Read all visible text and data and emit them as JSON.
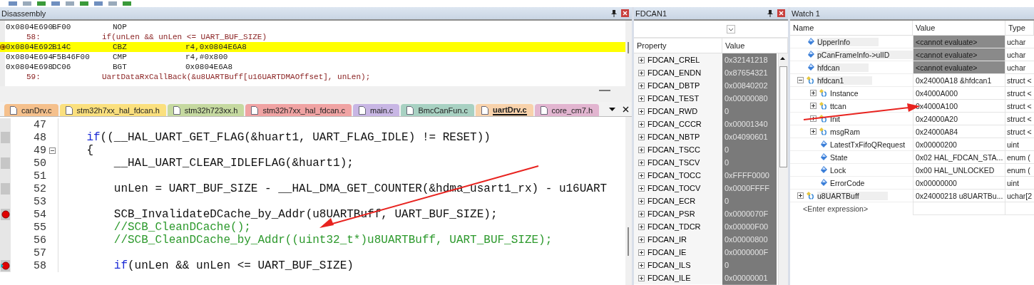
{
  "disassembly": {
    "title": "Disassembly",
    "rows": [
      {
        "kind": "instruction",
        "address": "0x0804E690",
        "opcode": "BF00",
        "mnemonic": "NOP",
        "current": false
      },
      {
        "kind": "source",
        "line": "58:",
        "code": "if(unLen && unLen <= UART_BUF_SIZE)"
      },
      {
        "kind": "instruction",
        "address": "0x0804E692",
        "opcode": "B14C",
        "mnemonic": "CBZ",
        "operands": "r4,0x0804E6A8",
        "current": true
      },
      {
        "kind": "instruction",
        "address": "0x0804E694",
        "opcode": "F5B46F00",
        "mnemonic": "CMP",
        "operands": "r4,#0x800",
        "current": false
      },
      {
        "kind": "instruction",
        "address": "0x0804E698",
        "opcode": "DC06",
        "mnemonic": "BGT",
        "operands": "0x0804E6A8",
        "current": false
      },
      {
        "kind": "source",
        "line": "59:",
        "code": "UartDataRxCallBack(&u8UARTBuff[u16UARTDMAOffset], unLen);"
      }
    ]
  },
  "editor": {
    "tabs": [
      {
        "label": "canDrv.c",
        "color": "#f5c08c",
        "selected": false
      },
      {
        "label": "stm32h7xx_hal_fdcan.h",
        "color": "#fbe07e",
        "selected": false
      },
      {
        "label": "stm32h723xx.h",
        "color": "#c5d9a0",
        "selected": false
      },
      {
        "label": "stm32h7xx_hal_fdcan.c",
        "color": "#f0a3a3",
        "selected": false
      },
      {
        "label": "main.c",
        "color": "#c8b6e4",
        "selected": false
      },
      {
        "label": "BmcCanFun.c",
        "color": "#a8d1c2",
        "selected": false
      },
      {
        "label": "uartDrv.c",
        "color": "#f8d2ab",
        "selected": true
      },
      {
        "label": "core_cm7.h",
        "color": "#e2b5d0",
        "selected": false
      }
    ],
    "lines": [
      {
        "number": "47",
        "executable": false,
        "breakpoint": false,
        "current": false,
        "fold": false
      },
      {
        "number": "48",
        "executable": true,
        "breakpoint": false,
        "current": false,
        "fold": false,
        "kind": "code",
        "parts": [
          {
            "kind": "keyword",
            "text": "    if"
          },
          {
            "kind": "plain",
            "text": "((__HAL_UART_GET_FLAG(&huart1, UART_FLAG_IDLE) != RESET))"
          }
        ]
      },
      {
        "number": "49",
        "executable": false,
        "breakpoint": false,
        "current": false,
        "fold": true,
        "kind": "code",
        "parts": [
          {
            "kind": "plain",
            "text": "    {"
          }
        ]
      },
      {
        "number": "50",
        "executable": true,
        "breakpoint": false,
        "current": false,
        "fold": false,
        "kind": "code",
        "parts": [
          {
            "kind": "plain",
            "text": "        __HAL_UART_CLEAR_IDLEFLAG(&huart1);"
          }
        ]
      },
      {
        "number": "51",
        "executable": false,
        "breakpoint": false,
        "current": false,
        "fold": false
      },
      {
        "number": "52",
        "executable": true,
        "breakpoint": false,
        "current": false,
        "fold": false,
        "kind": "code",
        "parts": [
          {
            "kind": "plain",
            "text": "        unLen = UART_BUF_SIZE - __HAL_DMA_GET_COUNTER(&hdma_usart1_rx) - u16UART"
          }
        ]
      },
      {
        "number": "53",
        "executable": false,
        "breakpoint": false,
        "current": false,
        "fold": false
      },
      {
        "number": "54",
        "executable": true,
        "breakpoint": true,
        "current": false,
        "fold": false,
        "kind": "code",
        "parts": [
          {
            "kind": "plain",
            "text": "        SCB_InvalidateDCache_by_Addr(u8UARTBuff, UART_BUF_SIZE);"
          }
        ]
      },
      {
        "number": "55",
        "executable": false,
        "breakpoint": false,
        "current": false,
        "fold": false,
        "kind": "comment",
        "parts": [
          {
            "kind": "plain",
            "text": "        //SCB_CleanDCache();"
          }
        ]
      },
      {
        "number": "56",
        "executable": false,
        "breakpoint": false,
        "current": false,
        "fold": false,
        "kind": "comment",
        "parts": [
          {
            "kind": "plain",
            "text": "        //SCB_CleanDCache_by_Addr((uint32_t*)u8UARTBuff, UART_BUF_SIZE);"
          }
        ]
      },
      {
        "number": "57",
        "executable": false,
        "breakpoint": false,
        "current": false,
        "fold": false
      },
      {
        "number": "58",
        "executable": true,
        "breakpoint": true,
        "current": true,
        "fold": false,
        "kind": "code",
        "parts": [
          {
            "kind": "keyword",
            "text": "        if"
          },
          {
            "kind": "plain",
            "text": "(unLen && unLen <= UART_BUF_SIZE)"
          }
        ]
      }
    ]
  },
  "registers": {
    "title": "FDCAN1",
    "columns": [
      "Property",
      "Value"
    ],
    "rows": [
      {
        "property": "FDCAN_CREL",
        "value": "0x32141218",
        "expanded": false
      },
      {
        "property": "FDCAN_ENDN",
        "value": "0x87654321",
        "expanded": false
      },
      {
        "property": "FDCAN_DBTP",
        "value": "0x00840202",
        "expanded": false
      },
      {
        "property": "FDCAN_TEST",
        "value": "0x00000080",
        "expanded": false
      },
      {
        "property": "FDCAN_RWD",
        "value": "0",
        "expanded": false
      },
      {
        "property": "FDCAN_CCCR",
        "value": "0x00001340",
        "expanded": false
      },
      {
        "property": "FDCAN_NBTP",
        "value": "0x04090601",
        "expanded": false
      },
      {
        "property": "FDCAN_TSCC",
        "value": "0",
        "expanded": false
      },
      {
        "property": "FDCAN_TSCV",
        "value": "0",
        "expanded": false
      },
      {
        "property": "FDCAN_TOCC",
        "value": "0xFFFF0000",
        "expanded": false
      },
      {
        "property": "FDCAN_TOCV",
        "value": "0x0000FFFF",
        "expanded": false
      },
      {
        "property": "FDCAN_ECR",
        "value": "0",
        "expanded": false
      },
      {
        "property": "FDCAN_PSR",
        "value": "0x0000070F",
        "expanded": false
      },
      {
        "property": "FDCAN_TDCR",
        "value": "0x00000F00",
        "expanded": false
      },
      {
        "property": "FDCAN_IR",
        "value": "0x00000800",
        "expanded": false
      },
      {
        "property": "FDCAN_IE",
        "value": "0x0000000F",
        "expanded": false
      },
      {
        "property": "FDCAN_ILS",
        "value": "0",
        "expanded": false
      },
      {
        "property": "FDCAN_ILE",
        "value": "0x00000001",
        "expanded": false
      }
    ]
  },
  "watch": {
    "title": "Watch 1",
    "columns": [
      "Name",
      "Value",
      "Type"
    ],
    "items": [
      {
        "name": "UpperInfo",
        "kind": "variable",
        "value": "<cannot evaluate>",
        "type": "uchar",
        "unavailable": true
      },
      {
        "name": "pCanFrameInfo->ulID",
        "kind": "variable",
        "value": "<cannot evaluate>",
        "type": "uchar",
        "unavailable": true
      },
      {
        "name": "hfdcan",
        "kind": "variable",
        "value": "<cannot evaluate>",
        "type": "uchar",
        "unavailable": true
      },
      {
        "name": "hfdcan1",
        "kind": "struct",
        "expanded": true,
        "value": "0x24000A18 &hfdcan1",
        "type": "struct <",
        "unavailable": false,
        "children": [
          {
            "name": "Instance",
            "kind": "struct",
            "expanded": false,
            "value": "0x4000A000",
            "type": "struct <",
            "unavailable": false
          },
          {
            "name": "ttcan",
            "kind": "struct",
            "expanded": false,
            "value": "0x4000A100",
            "type": "struct <",
            "unavailable": false
          },
          {
            "name": "Init",
            "kind": "struct",
            "expanded": false,
            "value": "0x24000A20",
            "type": "struct <",
            "unavailable": false
          },
          {
            "name": "msgRam",
            "kind": "struct",
            "expanded": false,
            "value": "0x24000A84",
            "type": "struct <",
            "unavailable": false
          },
          {
            "name": "LatestTxFifoQRequest",
            "kind": "variable",
            "value": "0x00000200",
            "type": "uint",
            "unavailable": false
          },
          {
            "name": "State",
            "kind": "variable",
            "value": "0x02 HAL_FDCAN_STA...",
            "type": "enum (",
            "unavailable": false
          },
          {
            "name": "Lock",
            "kind": "variable",
            "value": "0x00 HAL_UNLOCKED",
            "type": "enum (",
            "unavailable": false
          },
          {
            "name": "ErrorCode",
            "kind": "variable",
            "value": "0x00000000",
            "type": "uint",
            "unavailable": false
          }
        ]
      },
      {
        "name": "u8UARTBuff",
        "kind": "struct",
        "expanded": false,
        "value": "0x24000218 u8UARTBu...",
        "type": "uchar[2",
        "unavailable": false
      }
    ],
    "placeholder": "<Enter expression>"
  }
}
